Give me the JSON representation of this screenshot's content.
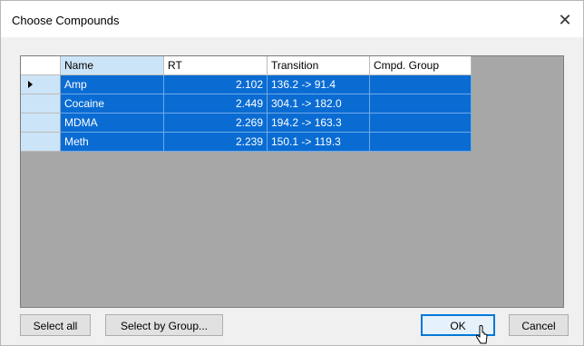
{
  "window": {
    "title": "Choose Compounds",
    "close_glyph": "✕"
  },
  "grid": {
    "columns": [
      "Name",
      "RT",
      "Transition",
      "Cmpd. Group"
    ],
    "rows": [
      {
        "name": "Amp",
        "rt": "2.102",
        "transition": "136.2 -> 91.4",
        "group": "",
        "current": true
      },
      {
        "name": "Cocaine",
        "rt": "2.449",
        "transition": "304.1 -> 182.0",
        "group": "",
        "current": false
      },
      {
        "name": "MDMA",
        "rt": "2.269",
        "transition": "194.2 -> 163.3",
        "group": "",
        "current": false
      },
      {
        "name": "Meth",
        "rt": "2.239",
        "transition": "150.1 -> 119.3",
        "group": "",
        "current": false
      }
    ]
  },
  "buttons": {
    "select_all": "Select all",
    "select_by_group": "Select by Group...",
    "ok": "OK",
    "cancel": "Cancel"
  },
  "colors": {
    "selection": "#0a6cd3",
    "header_selected": "#cce4f7",
    "grid_background": "#a7a7a7"
  }
}
